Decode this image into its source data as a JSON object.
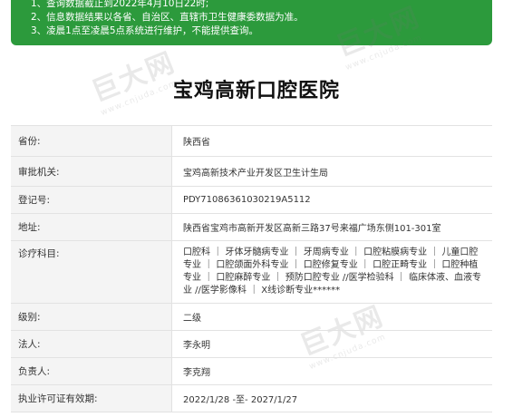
{
  "notice": {
    "lines": [
      "1、查询数据截止到2022年4月10日22时;",
      "2、信息数据结果以各省、自治区、直辖市卫生健康委数据为准。",
      "3、凌晨1点至凌晨5点系统进行维护，不能提供查询。"
    ]
  },
  "title": "宝鸡高新口腔医院",
  "rows": [
    {
      "label": "省份:",
      "value": "陕西省"
    },
    {
      "label": "审批机关:",
      "value": "宝鸡高新技术产业开发区卫生计生局"
    },
    {
      "label": "登记号:",
      "value": "PDY71086361030219A5112"
    },
    {
      "label": "地址:",
      "value": "陕西省宝鸡市高新开发区高新三路37号来福广场东侧101-301室"
    },
    {
      "label": "诊疗科目:",
      "value": "口腔科 ｜ 牙体牙髓病专业 ｜ 牙周病专业 ｜ 口腔粘膜病专业 ｜ 儿童口腔专业 ｜ 口腔颌面外科专业 ｜ 口腔修复专业 ｜ 口腔正畸专业 ｜ 口腔种植专业 ｜ 口腔麻醉专业 ｜ 预防口腔专业 //医学检验科 ｜ 临床体液、血液专业 //医学影像科 ｜ X线诊断专业******"
    },
    {
      "label": "级别:",
      "value": "二级"
    },
    {
      "label": "法人:",
      "value": "李永明"
    },
    {
      "label": "负责人:",
      "value": "李克翔"
    },
    {
      "label": "执业许可证有效期:",
      "value": "2022/1/28 -至- 2027/1/27"
    }
  ],
  "watermark": {
    "text": "巨大网",
    "url": "www.cnjuda.com"
  },
  "colors": {
    "notice_bg": "#2c9a3c",
    "label_bg": "#f4f4f4",
    "border": "#e2e2e2"
  }
}
